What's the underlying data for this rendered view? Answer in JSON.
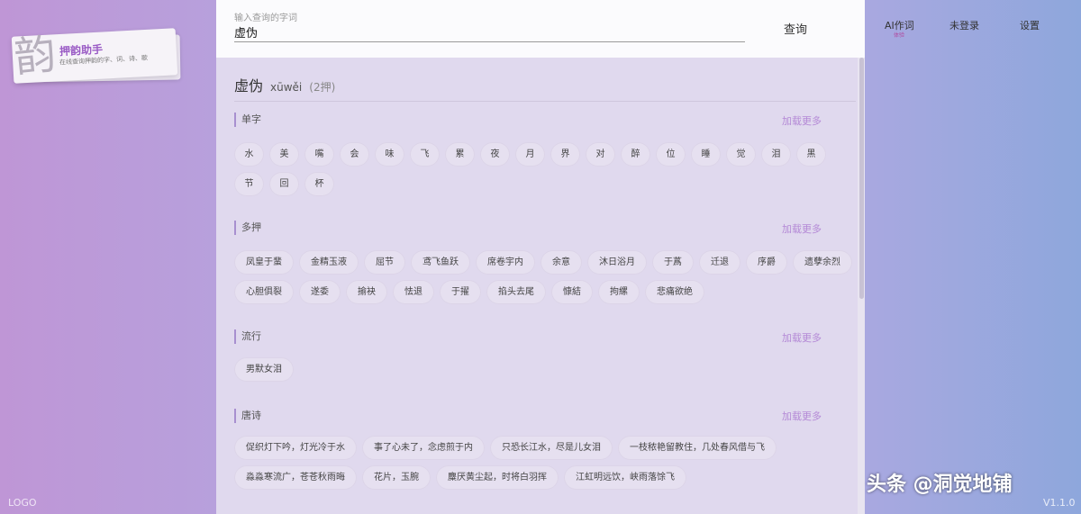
{
  "brand": {
    "glyph": "韵",
    "title": "押韵助手",
    "subtitle": "在线查询押韵的字、词、诗、歌",
    "logo": "LOGO"
  },
  "search": {
    "label": "输入查询的字词",
    "value": "虚伪",
    "button": "查询"
  },
  "result": {
    "word": "虚伪",
    "pinyin": "xūwěi",
    "count": "(2押)"
  },
  "load_more": "加载更多",
  "sections": [
    {
      "title": "单字",
      "items": [
        "水",
        "美",
        "嘴",
        "会",
        "味",
        "飞",
        "累",
        "夜",
        "月",
        "界",
        "对",
        "醉",
        "位",
        "睡",
        "觉",
        "泪",
        "黑",
        "节",
        "回",
        "杯"
      ]
    },
    {
      "title": "多押",
      "items": [
        "凤皇于蜚",
        "金精玉液",
        "屈节",
        "鸢飞鱼跃",
        "席卷宇内",
        "余意",
        "沐日浴月",
        "于蔿",
        "迁退",
        "序爵",
        "遗孽余烈",
        "心胆俱裂",
        "遂委",
        "揄袂",
        "怯退",
        "于擢",
        "掐头去尾",
        "慷結",
        "拘縲",
        "悲痛欲绝"
      ]
    },
    {
      "title": "流行",
      "items": [
        "男默女泪"
      ]
    },
    {
      "title": "唐诗",
      "items": [
        "促织灯下吟，灯光冷于水",
        "事了心未了，念虑煎于内",
        "只恐长江水，尽是儿女泪",
        "一枝秾艳留教住，几处春风借与飞",
        "淼淼寒流广，苍苍秋雨晦",
        "花片，玉腕",
        "麋厌黄尘起，时将白羽挥",
        "江虹明远饮，峡雨落馀飞"
      ]
    }
  ],
  "menu": {
    "ai": "AI作词",
    "ai_sub": "体验",
    "login": "未登录",
    "settings": "设置"
  },
  "version": "V1.1.0",
  "watermark": "头条 @洞觉地铺"
}
